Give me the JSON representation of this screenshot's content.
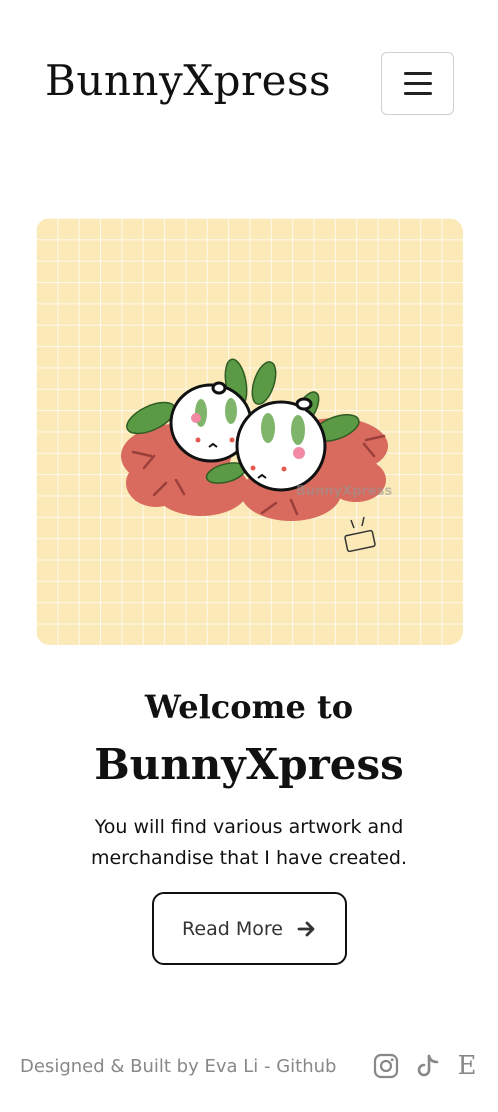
{
  "nav": {
    "brand": "BunnyXpress",
    "menu_icon": "hamburger-icon"
  },
  "hero": {
    "image_alt": "Two bunny mochi characters on green leaves with red flowers",
    "watermark": "BunnyXpress",
    "background_color": "#fbe9b8"
  },
  "content": {
    "welcome": "Welcome to",
    "title": "BunnyXpress",
    "description": "You will find various artwork and merchandise that I have created.",
    "read_more_label": "Read More",
    "read_more_icon": "arrow-right-icon"
  },
  "footer": {
    "credit_prefix": "Designed & Built by Eva Li - ",
    "github_label": "Github",
    "social_icons": [
      "instagram-icon",
      "tiktok-icon",
      "etsy-icon"
    ],
    "etsy_letter": "E"
  },
  "colors": {
    "text": "#111111",
    "muted": "#888888",
    "leaf_green": "#5a9a45",
    "flower_red": "#d86b5e"
  }
}
